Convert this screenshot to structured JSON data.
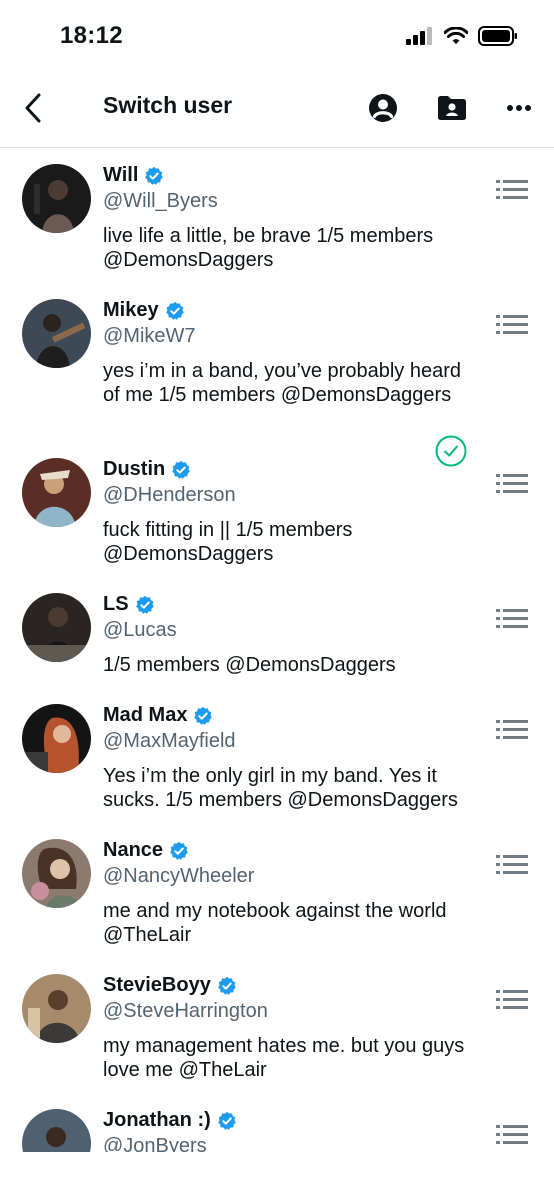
{
  "status_bar": {
    "time": "18:12"
  },
  "header": {
    "title": "Switch user"
  },
  "accounts": [
    {
      "name": "Will",
      "handle": "@Will_Byers",
      "bio": "live life a little, be brave 1/5 members @DemonsDaggers",
      "selected": false
    },
    {
      "name": "Mikey",
      "handle": "@MikeW7",
      "bio": "yes i’m in a band, you’ve probably heard of me 1/5 members @DemonsDaggers",
      "selected": true
    },
    {
      "name": "Dustin",
      "handle": "@DHenderson",
      "bio": "fuck fitting in || 1/5 members @DemonsDaggers",
      "selected": false
    },
    {
      "name": "LS",
      "handle": "@Lucas",
      "bio": "1/5 members @DemonsDaggers",
      "selected": false
    },
    {
      "name": "Mad Max",
      "handle": "@MaxMayfield",
      "bio": "Yes i’m the only girl in my band. Yes it sucks. 1/5 members @DemonsDaggers",
      "selected": false
    },
    {
      "name": "Nance",
      "handle": "@NancyWheeler",
      "bio": "me and my notebook against the world @TheLair",
      "selected": false
    },
    {
      "name": "StevieBoyy",
      "handle": "@SteveHarrington",
      "bio": "my management hates me. but you guys love me @TheLair",
      "selected": false
    },
    {
      "name": "Jonathan :)",
      "handle": "@JonByers",
      "bio": "",
      "selected": false
    }
  ],
  "colors": {
    "verified": "#1d9bf0",
    "selected_check": "#00ba7c",
    "handle": "#536471",
    "text": "#0f1419"
  },
  "icons": [
    "back-arrow-icon",
    "account-circle-icon",
    "contact-folder-icon",
    "more-icon",
    "verified-badge-icon",
    "drag-handle-icon",
    "check-circle-icon"
  ]
}
